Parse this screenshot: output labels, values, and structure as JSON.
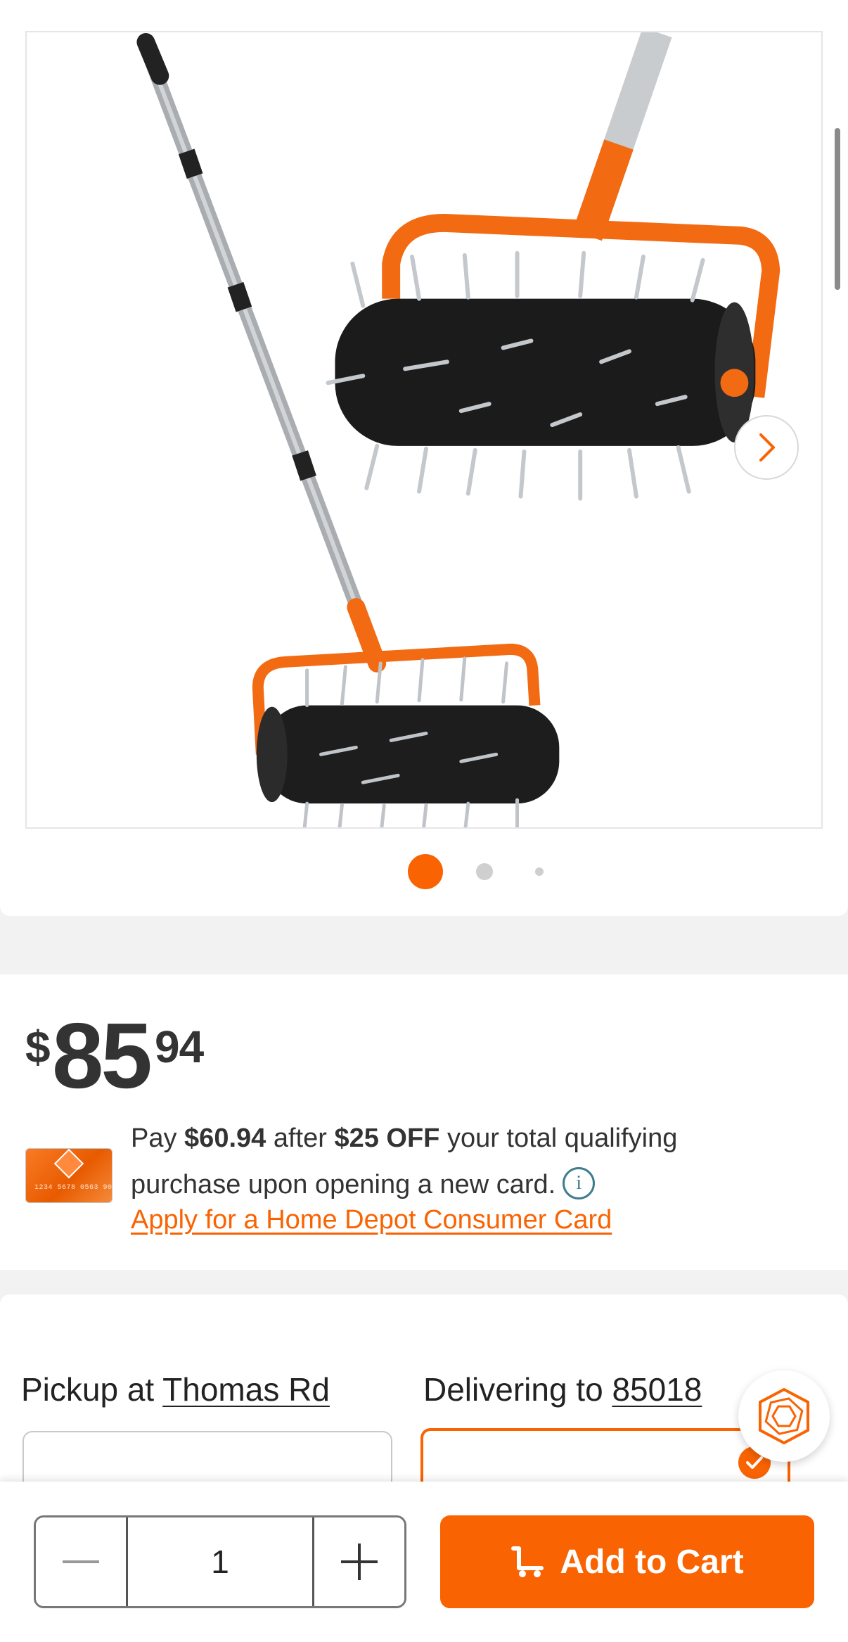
{
  "gallery": {
    "image_count": 3,
    "active_index": 1,
    "next_icon": "chevron-right-icon",
    "product_image": "spike-lawn-aerator-roller-photo"
  },
  "price": {
    "currency": "$",
    "dollars": "85",
    "cents": "94"
  },
  "promo": {
    "card_number": "1234 5678 0563 9024",
    "text_pay": "Pay ",
    "amount_after": "$60.94",
    "text_after": " after ",
    "discount": "$25 OFF",
    "text_rest": " your total qualifying purchase upon opening a new card.",
    "info_icon": "i",
    "apply_link": "Apply for a Home Depot Consumer Card"
  },
  "fulfillment": {
    "pickup_prefix": "Pickup at ",
    "pickup_store": "Thomas Rd",
    "delivery_prefix": "Delivering to ",
    "delivery_zip": "85018",
    "selected": "delivery"
  },
  "cart": {
    "quantity": "1",
    "add_label": "Add to Cart"
  },
  "colors": {
    "brand": "#f96302",
    "info": "#3e7d8c"
  }
}
